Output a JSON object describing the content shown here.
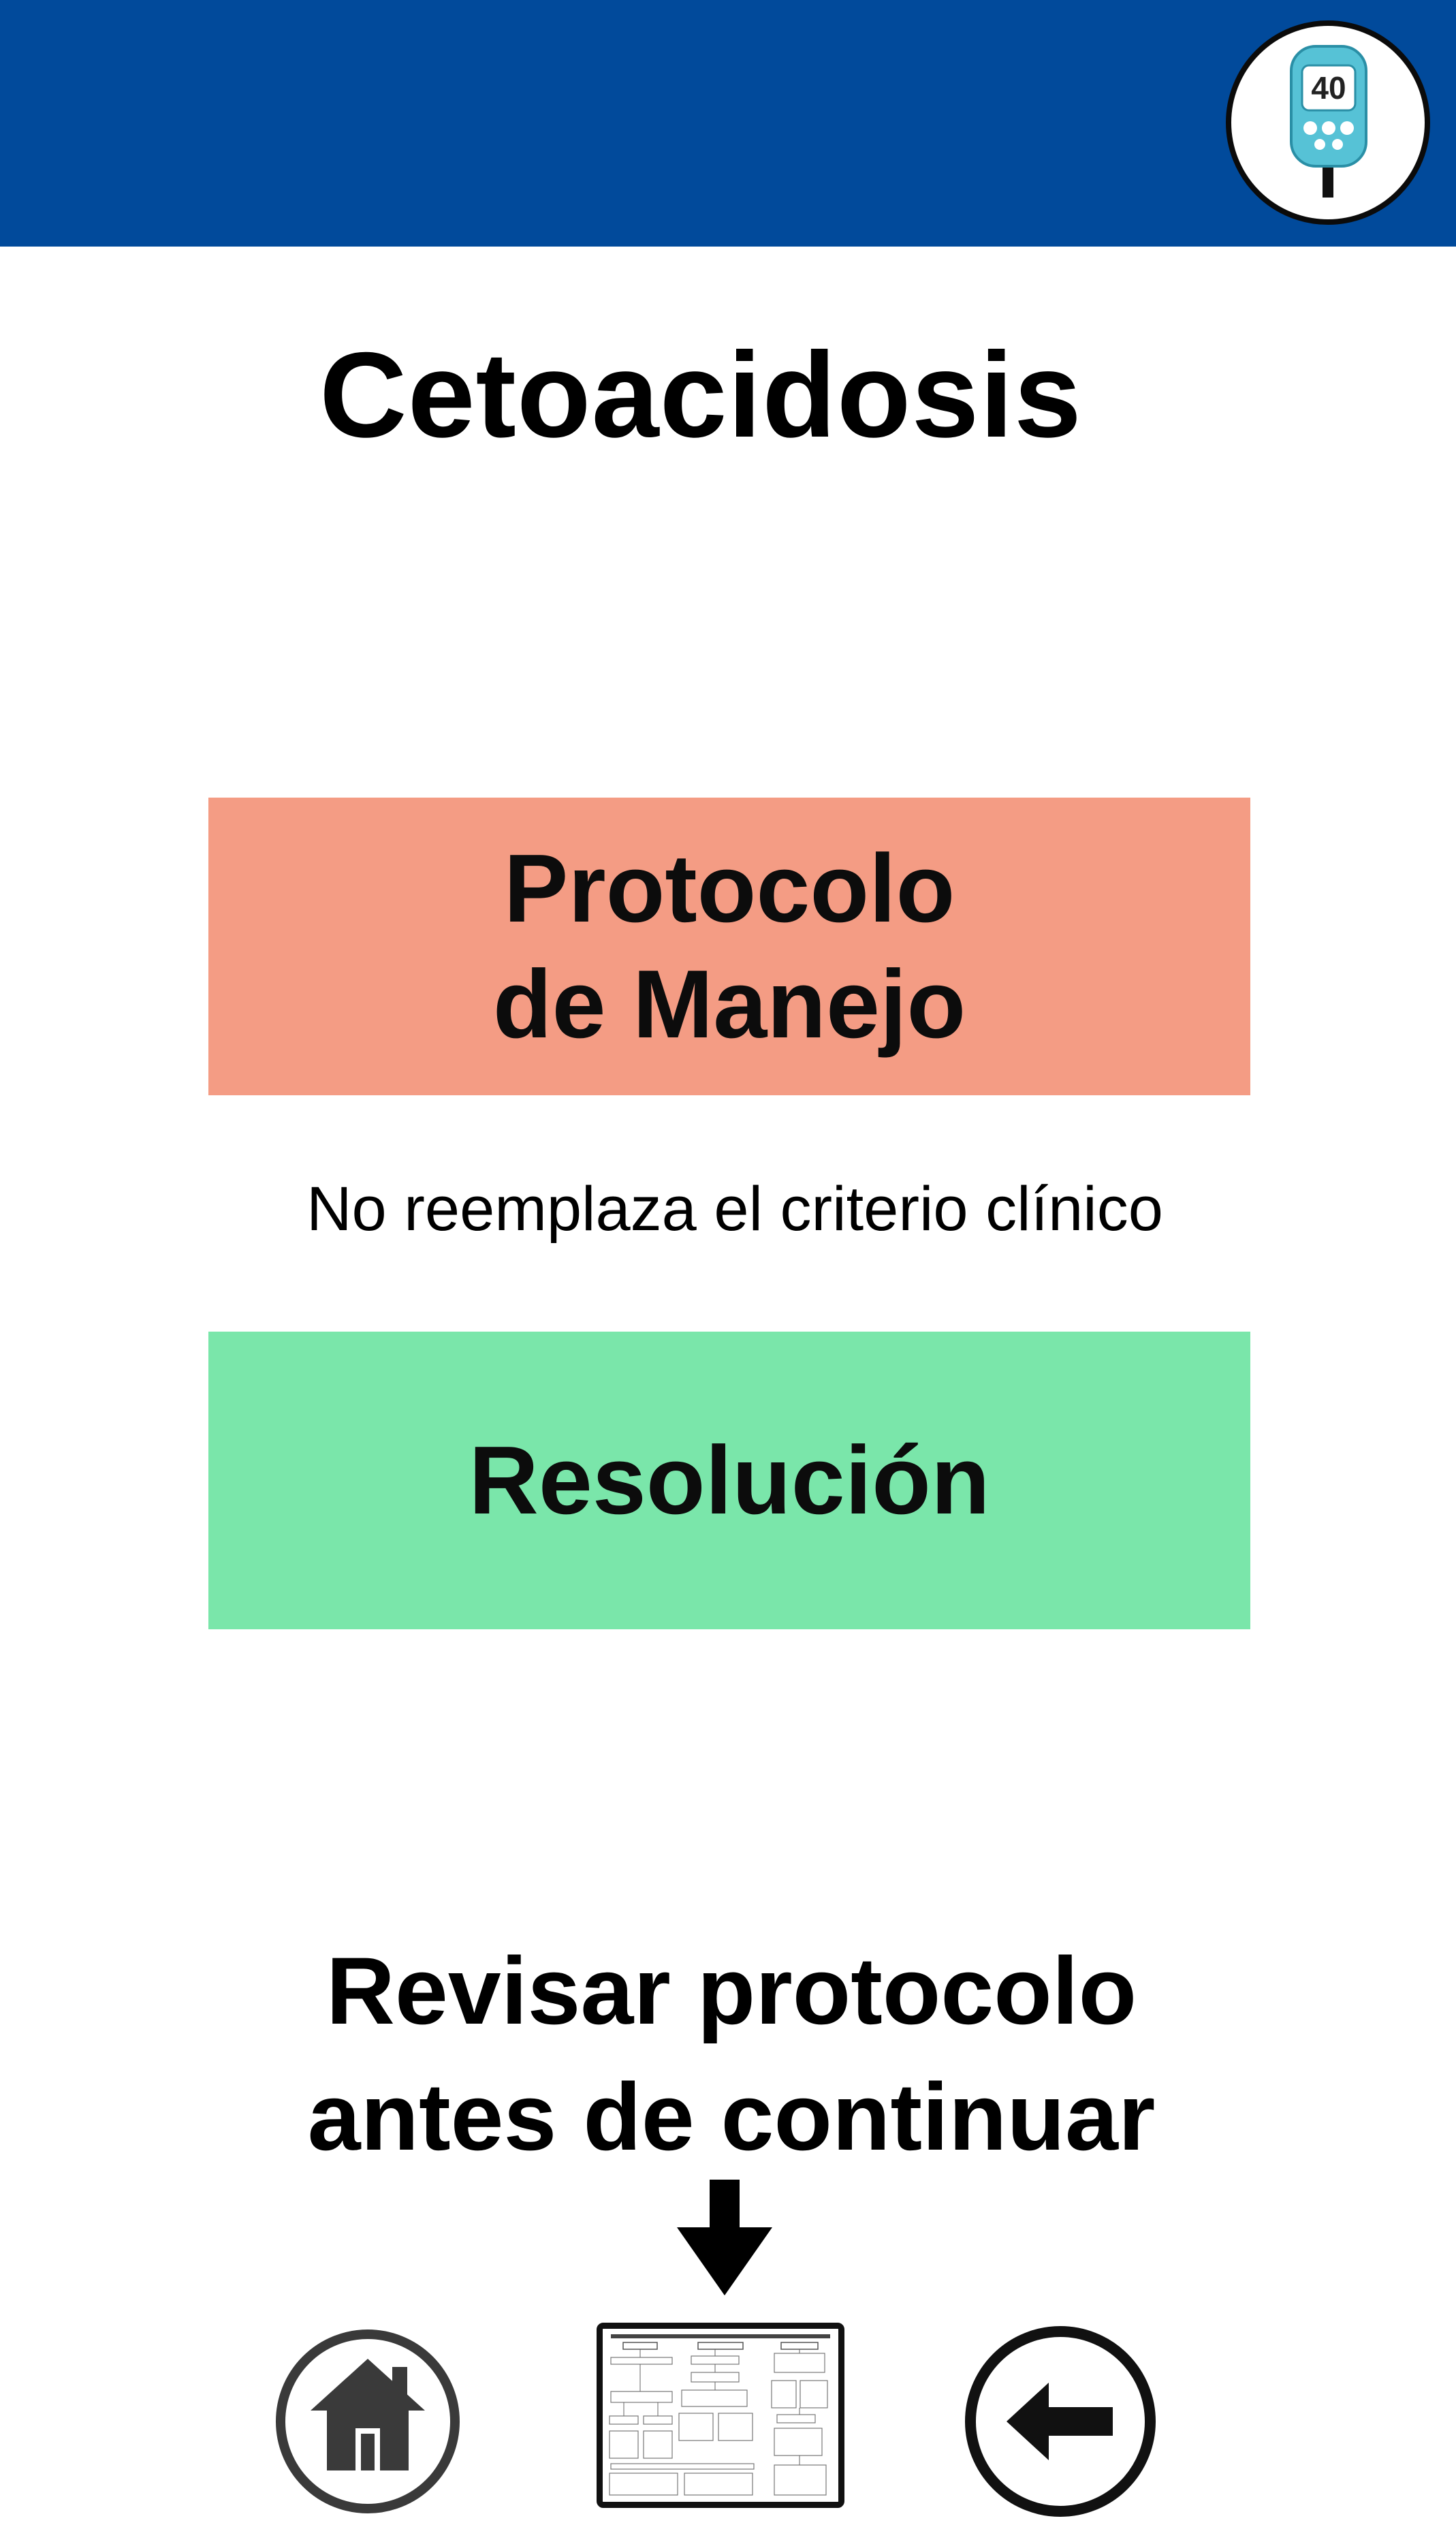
{
  "header": {
    "background_color": "#014a9b",
    "badge": {
      "icon": "glucometer-icon",
      "reading": "40"
    }
  },
  "page": {
    "title": "Cetoacidosis"
  },
  "buttons": {
    "protocol": {
      "line1": "Protocolo",
      "line2": "de Manejo",
      "color": "#f49c84"
    },
    "resolution": {
      "label": "Resolución",
      "color": "#7ae6aa"
    }
  },
  "disclaimer": "No reemplaza el criterio clínico",
  "review_note": {
    "line1": "Revisar protocolo",
    "line2": "antes de continuar"
  },
  "bottom_nav": {
    "home_icon": "home-icon",
    "protocol_icon": "protocol-flowchart-thumbnail",
    "back_icon": "back-arrow-icon",
    "pointer_icon": "down-arrow-icon"
  }
}
